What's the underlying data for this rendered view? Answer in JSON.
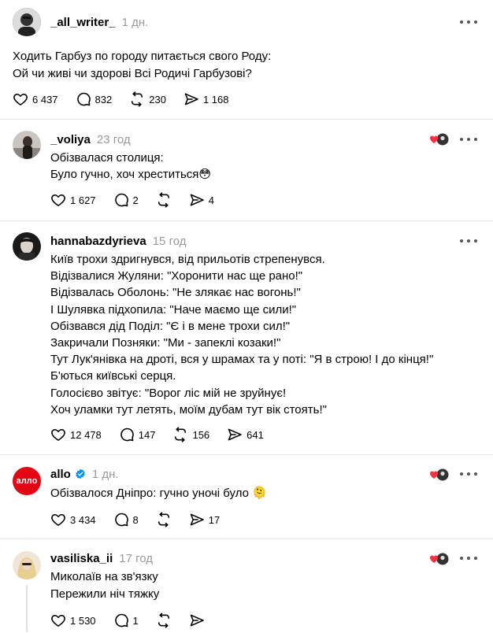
{
  "posts": [
    {
      "username": "_all_writer_",
      "time": "1 дн.",
      "text": "Ходить Гарбуз по городу питається свого Роду:\nОй чи живі чи здорові Всі Родичі Гарбузові?",
      "likes": "6 437",
      "replies": "832",
      "reposts": "230",
      "shares": "1 168"
    },
    {
      "username": "_voliya",
      "time": "23 год",
      "text": "Обізвалася столиця:\nБуло гучно, хоч хреститься😳",
      "likes": "1 627",
      "replies": "2",
      "reposts": "",
      "shares": "4"
    },
    {
      "username": "hannabazdyrieva",
      "time": "15 год",
      "text": "Київ трохи здригнувся, від прильотів стрепенувся.\nВідізвалися Жуляни: \"Хоронити нас ще рано!\"\nВідізвалась Оболонь: \"Не злякає нас вогонь!\"\nІ Шулявка підхопила: \"Наче маємо ще сили!\"\nОбізвався дід Поділ: \"Є і в мене трохи сил!\"\nЗакричали Позняки: \"Ми - запеклі козаки!\"\nТут Лук'янівка на дроті, вся у шрамах та у поті: \"Я в строю! І до кінця!\"\nБ'ються київські серця.\nГолосієво звітує: \"Ворог ліс мій не зруйнує!\nХоч уламки тут летять, моїм дубам тут вік стоять!\"",
      "likes": "12 478",
      "replies": "147",
      "reposts": "156",
      "shares": "641"
    },
    {
      "username": "allo",
      "time": "1 дн.",
      "text": "Обізвалося Дніпро: гучно уночі було 🫠",
      "likes": "3 434",
      "replies": "8",
      "reposts": "",
      "shares": "17",
      "avatar_text": "алло"
    },
    {
      "username": "vasiliska_ii",
      "time": "17 год",
      "text": "Миколаїв на зв'язку\nПережили ніч тяжку",
      "likes": "1 530",
      "replies": "1",
      "reposts": "",
      "shares": ""
    }
  ],
  "colors": {
    "accent_red": "#e30613",
    "verified_blue": "#0095f6",
    "like_red": "#ff3040",
    "muted": "#999999"
  },
  "icons": [
    "heart-icon",
    "comment-icon",
    "repost-icon",
    "share-icon",
    "more-icon",
    "verified-icon"
  ]
}
